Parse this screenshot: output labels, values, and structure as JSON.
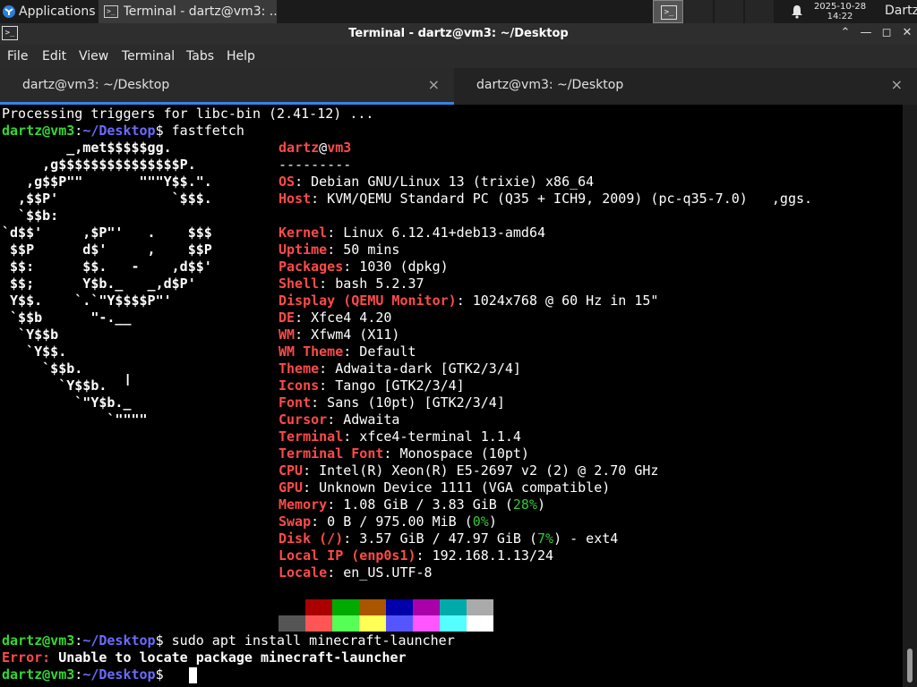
{
  "panel": {
    "apps_label": "Applications",
    "task_label": "Terminal - dartz@vm3: ...",
    "clock_date": "2025-10-28",
    "clock_time": "14:22",
    "user": "Dartz"
  },
  "window": {
    "title": "Terminal - dartz@vm3: ~/Desktop"
  },
  "menu": [
    "File",
    "Edit",
    "View",
    "Terminal",
    "Tabs",
    "Help"
  ],
  "tabs": [
    {
      "label": "dartz@vm3: ~/Desktop",
      "active": true
    },
    {
      "label": "dartz@vm3: ~/Desktop",
      "active": false
    }
  ],
  "terminal": {
    "line_trigger": "Processing triggers for libc-bin (2.41-12) ...",
    "prompt_user": "dartz@vm3",
    "prompt_path": "~/Desktop",
    "cmd1": "fastfetch",
    "logo": [
      "        _,met$$$$$gg.",
      "     ,g$$$$$$$$$$$$$$$P.",
      "   ,g$$P\"\"       \"\"\"Y$$.\".",
      "  ,$$P'              `$$$.",
      "  `$$b:",
      "`d$$'     ,$P\"'   .    $$$",
      " $$P      d$'     ,    $$P",
      " $$:      $$.   -    ,d$$'",
      " $$;      Y$b._   _,d$P'",
      " Y$$.    `.`\"Y$$$$P\"'",
      " `$$b      \"-.__",
      "  `Y$$b",
      "   `Y$$.",
      "     `$$b.",
      "       `Y$$b.",
      "         `\"Y$b._",
      "             `\"\"\"\""
    ],
    "host_user": "dartz",
    "host_at": "@",
    "host_name": "vm3",
    "separator": "---------",
    "info": [
      {
        "k": "OS",
        "v": "Debian GNU/Linux 13 (trixie) x86_64"
      },
      {
        "k": "Host",
        "v": "KVM/QEMU Standard PC (Q35 + ICH9, 2009) (pc-q35-7.0)   ,ggs."
      },
      {
        "k": "Kernel",
        "v": "Linux 6.12.41+deb13-amd64"
      },
      {
        "k": "Uptime",
        "v": "50 mins"
      },
      {
        "k": "Packages",
        "v": "1030 (dpkg)"
      },
      {
        "k": "Shell",
        "v": "bash 5.2.37"
      },
      {
        "k": "Display (QEMU Monitor)",
        "v": "1024x768 @ 60 Hz in 15\""
      },
      {
        "k": "DE",
        "v": "Xfce4 4.20"
      },
      {
        "k": "WM",
        "v": "Xfwm4 (X11)"
      },
      {
        "k": "WM Theme",
        "v": "Default"
      },
      {
        "k": "Theme",
        "v": "Adwaita-dark [GTK2/3/4]"
      },
      {
        "k": "Icons",
        "v": "Tango [GTK2/3/4]"
      },
      {
        "k": "Font",
        "v": "Sans (10pt) [GTK2/3/4]"
      },
      {
        "k": "Cursor",
        "v": "Adwaita"
      },
      {
        "k": "Terminal",
        "v": "xfce4-terminal 1.1.4"
      },
      {
        "k": "Terminal Font",
        "v": "Monospace (10pt)"
      },
      {
        "k": "CPU",
        "v": "Intel(R) Xeon(R) E5-2697 v2 (2) @ 2.70 GHz"
      },
      {
        "k": "GPU",
        "v": "Unknown Device 1111 (VGA compatible)"
      }
    ],
    "memory": {
      "k": "Memory",
      "v1": "1.08 GiB / 3.83 GiB (",
      "pct": "28%",
      "v2": ")"
    },
    "swap": {
      "k": "Swap",
      "v1": "0 B / 975.00 MiB (",
      "pct": "0%",
      "v2": ")"
    },
    "disk": {
      "k": "Disk (/)",
      "v1": "3.57 GiB / 47.97 GiB (",
      "pct": "7%",
      "v2": ") - ext4"
    },
    "local_ip": {
      "k": "Local IP (enp0s1)",
      "v": "192.168.1.13/24"
    },
    "locale": {
      "k": "Locale",
      "v": "en_US.UTF-8"
    },
    "palette_top": [
      "#000000",
      "#aa0000",
      "#00aa00",
      "#aa5500",
      "#0000aa",
      "#aa00aa",
      "#00aaaa",
      "#aaaaaa"
    ],
    "palette_bottom": [
      "#555555",
      "#ff5555",
      "#55ff55",
      "#ffff55",
      "#5555ff",
      "#ff55ff",
      "#55ffff",
      "#ffffff"
    ],
    "cmd2": "sudo apt install minecraft-launcher",
    "error_label": "Error:",
    "error_msg": " Unable to locate package minecraft-launcher"
  }
}
